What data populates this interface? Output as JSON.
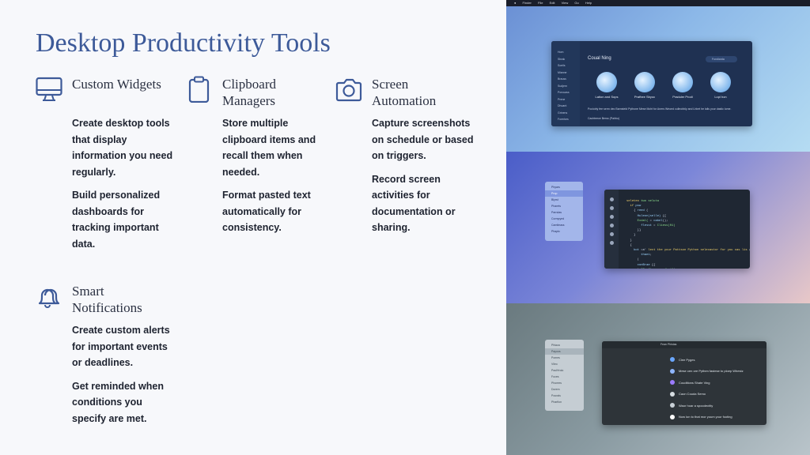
{
  "title": "Desktop Productivity Tools",
  "features": [
    {
      "icon": "monitor-icon",
      "title": "Custom Widgets",
      "paragraphs": [
        "Create desktop tools that display information you need regularly.",
        "Build personalized dashboards for tracking important data."
      ]
    },
    {
      "icon": "clipboard-icon",
      "title": "Clipboard Managers",
      "paragraphs": [
        "Store multiple clipboard items and recall them when needed.",
        "Format pasted text automatically for consistency."
      ]
    },
    {
      "icon": "camera-icon",
      "title": "Screen Automation",
      "paragraphs": [
        "Capture screenshots on schedule or based on triggers.",
        "Record screen activities for documentation or sharing."
      ]
    },
    {
      "icon": "bell-icon",
      "title": "Smart Notifications",
      "paragraphs": [
        "Create custom alerts for important events or deadlines.",
        "Get reminded when conditions you specify are met."
      ]
    }
  ],
  "screens": {
    "menubar": [
      "Finder",
      "File",
      "Edit",
      "View",
      "Go",
      "Help"
    ],
    "window1": {
      "title": "Coual Ning",
      "search": "Fondiarda",
      "sidebar": [
        "Hom",
        "Sbrak",
        "Soeils",
        "Mianne",
        "Brauss",
        "Sudjern",
        "Porcuass",
        "Prene",
        "Dhuant",
        "Grinens",
        "Forerkes"
      ],
      "apps": [
        "Lation and Sops",
        "Prafhee Sbyoc",
        "Praduler Prodi",
        "Lopl hon"
      ],
      "description": "Pociobly fee serm dec Barnsteld Pythone Mese Mcht for Aners Weoed culleobbly and Lhbet he lalls your dastic lome.",
      "checkbox": "Cachteece Berss (Pahbu)"
    },
    "window2": {
      "sidebar": [
        "Phyars",
        "Prop",
        "Blyrst",
        "Pharets",
        "Parndas",
        "Cormpyed",
        "Camlteass",
        "Phaptc"
      ]
    },
    "window3": {
      "titlebar": "Fean Phistas",
      "sidebar": [
        "Phlaca",
        "Payoos",
        "Pomes",
        "Vileo",
        "PaolHrolo",
        "Foces",
        "Phorees",
        "Dorem",
        "Pourals",
        "Pharfion"
      ],
      "rows": [
        "Clee Pyges",
        "Mese cen ore Pythen fastese to ploep Whestz",
        "Couditions Shate Ving",
        "Caon Couda Semo",
        "Waor hoar a spoodectity",
        "Now lon to that mor youm your footing"
      ]
    }
  }
}
